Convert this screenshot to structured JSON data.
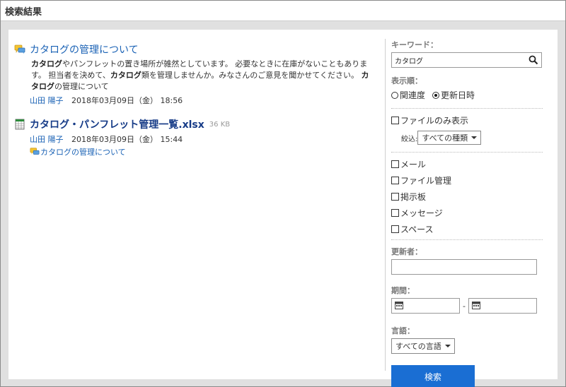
{
  "page": {
    "title": "検索結果"
  },
  "results": [
    {
      "icon": "message-icon",
      "title": "カタログの管理について",
      "snippet": [
        {
          "text": "カタログ",
          "bold": true
        },
        {
          "text": "やパンフレットの置き場所が雑然としています。 必要なときに在庫がないこともあります。 担当者を決めて、",
          "bold": false
        },
        {
          "text": "カタログ",
          "bold": true
        },
        {
          "text": "類を管理しませんか。みなさんのご意見を聞かせてください。 ",
          "bold": false
        },
        {
          "text": "カタログ",
          "bold": true
        },
        {
          "text": "の管理について",
          "bold": false
        }
      ],
      "author": "山田 陽子",
      "datetime": "2018年03月09日（金） 18:56"
    },
    {
      "icon": "spreadsheet-icon",
      "title": "カタログ・パンフレット管理一覧.xlsx",
      "size": "36 KB",
      "author": "山田 陽子",
      "datetime": "2018年03月09日（金） 15:44",
      "related": "カタログの管理について"
    }
  ],
  "sidebar": {
    "keyword_label": "キーワード：",
    "keyword_value": "カタログ",
    "sort_label": "表示順：",
    "sort_options": [
      {
        "label": "関連度",
        "selected": false
      },
      {
        "label": "更新日時",
        "selected": true
      }
    ],
    "file_only_label": "ファイルのみ表示",
    "narrow_label": "絞込:",
    "narrow_value": "すべての種類",
    "categories": [
      "メール",
      "ファイル管理",
      "掲示板",
      "メッセージ",
      "スペース"
    ],
    "updater_label": "更新者：",
    "period_label": "期間：",
    "period_sep": "-",
    "language_label": "言語：",
    "language_value": "すべての言語",
    "search_button": "検索"
  },
  "colors": {
    "accent": "#1a6ed3",
    "link": "#1a62b5",
    "background": "#e0e0e0"
  }
}
